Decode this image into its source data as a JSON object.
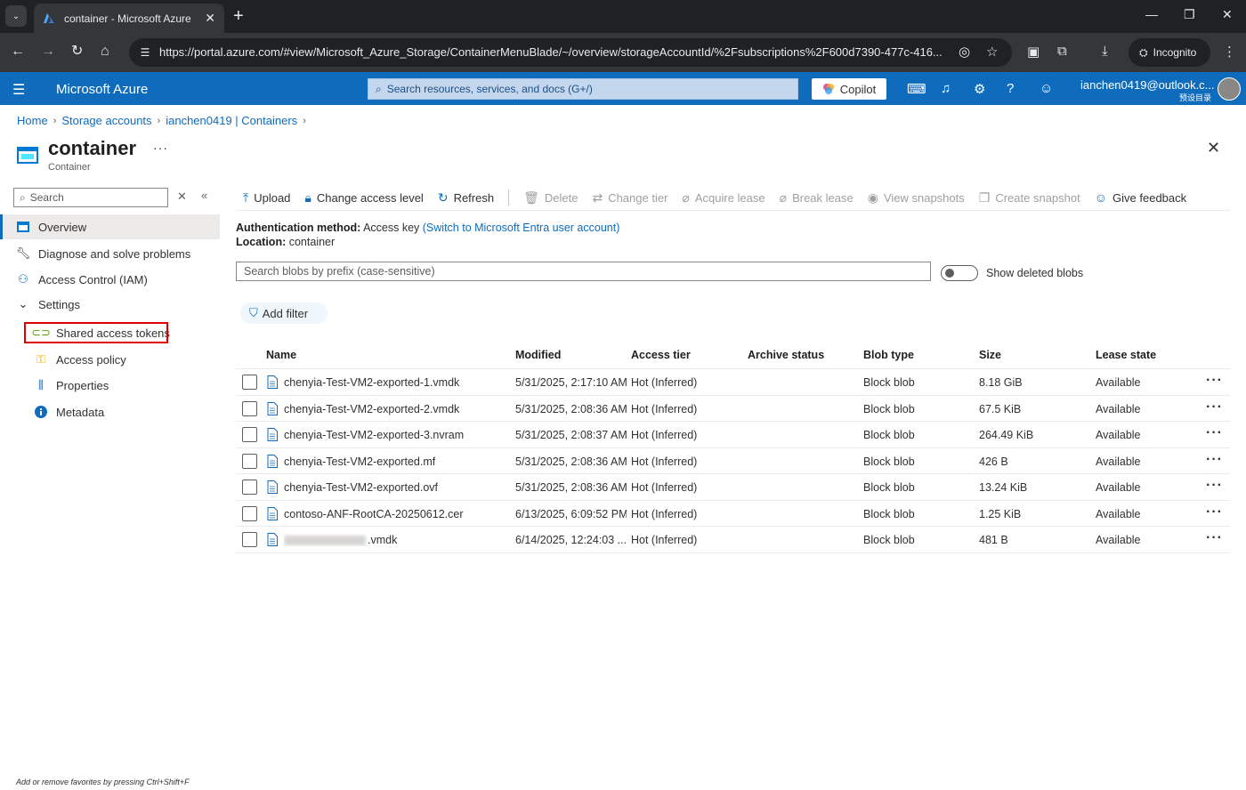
{
  "browser": {
    "tab_title": "container - Microsoft Azure",
    "url": "https://portal.azure.com/#view/Microsoft_Azure_Storage/ContainerMenuBlade/~/overview/storageAccountId/%2Fsubscriptions%2F600d7390-477c-416...",
    "incognito_label": "Incognito"
  },
  "header": {
    "brand": "Microsoft Azure",
    "search_placeholder": "Search resources, services, and docs (G+/)",
    "copilot_label": "Copilot",
    "user_email": "ianchen0419@outlook.c...",
    "user_directory": "预设目录"
  },
  "breadcrumb": [
    "Home",
    "Storage accounts",
    "ianchen0419 | Containers"
  ],
  "page": {
    "title": "container",
    "subtitle": "Container",
    "more": "···"
  },
  "nav": {
    "search_placeholder": "Search",
    "items": [
      {
        "label": "Overview",
        "icon": "overview-icon"
      },
      {
        "label": "Diagnose and solve problems",
        "icon": "wrench-icon"
      },
      {
        "label": "Access Control (IAM)",
        "icon": "people-icon"
      },
      {
        "label": "Settings",
        "icon": "chevron-down-icon"
      },
      {
        "label": "Shared access tokens",
        "icon": "link-icon"
      },
      {
        "label": "Access policy",
        "icon": "key-icon"
      },
      {
        "label": "Properties",
        "icon": "properties-icon"
      },
      {
        "label": "Metadata",
        "icon": "info-icon"
      }
    ],
    "favorites_hint": "Add or remove favorites by pressing Ctrl+Shift+F"
  },
  "commands": {
    "upload": "Upload",
    "change_access": "Change access level",
    "refresh": "Refresh",
    "delete": "Delete",
    "change_tier": "Change tier",
    "acquire_lease": "Acquire lease",
    "break_lease": "Break lease",
    "view_snapshots": "View snapshots",
    "create_snapshot": "Create snapshot",
    "give_feedback": "Give feedback"
  },
  "info": {
    "auth_label": "Authentication method:",
    "auth_value": "Access key",
    "auth_link": "(Switch to Microsoft Entra user account)",
    "location_label": "Location:",
    "location_value": "container"
  },
  "blob_search_placeholder": "Search blobs by prefix (case-sensitive)",
  "show_deleted_label": "Show deleted blobs",
  "add_filter_label": "Add filter",
  "table": {
    "columns": [
      "Name",
      "Modified",
      "Access tier",
      "Archive status",
      "Blob type",
      "Size",
      "Lease state"
    ],
    "rows": [
      {
        "name": "chenyia-Test-VM2-exported-1.vmdk",
        "modified": "5/31/2025, 2:17:10 AM",
        "tier": "Hot (Inferred)",
        "archive": "",
        "type": "Block blob",
        "size": "8.18 GiB",
        "lease": "Available"
      },
      {
        "name": "chenyia-Test-VM2-exported-2.vmdk",
        "modified": "5/31/2025, 2:08:36 AM",
        "tier": "Hot (Inferred)",
        "archive": "",
        "type": "Block blob",
        "size": "67.5 KiB",
        "lease": "Available"
      },
      {
        "name": "chenyia-Test-VM2-exported-3.nvram",
        "modified": "5/31/2025, 2:08:37 AM",
        "tier": "Hot (Inferred)",
        "archive": "",
        "type": "Block blob",
        "size": "264.49 KiB",
        "lease": "Available"
      },
      {
        "name": "chenyia-Test-VM2-exported.mf",
        "modified": "5/31/2025, 2:08:36 AM",
        "tier": "Hot (Inferred)",
        "archive": "",
        "type": "Block blob",
        "size": "426 B",
        "lease": "Available"
      },
      {
        "name": "chenyia-Test-VM2-exported.ovf",
        "modified": "5/31/2025, 2:08:36 AM",
        "tier": "Hot (Inferred)",
        "archive": "",
        "type": "Block blob",
        "size": "13.24 KiB",
        "lease": "Available"
      },
      {
        "name": "contoso-ANF-RootCA-20250612.cer",
        "modified": "6/13/2025, 6:09:52 PM",
        "tier": "Hot (Inferred)",
        "archive": "",
        "type": "Block blob",
        "size": "1.25 KiB",
        "lease": "Available"
      },
      {
        "name": ".vmdk",
        "modified": "6/14/2025, 12:24:03 ...",
        "tier": "Hot (Inferred)",
        "archive": "",
        "type": "Block blob",
        "size": "481 B",
        "lease": "Available",
        "name_redacted": true
      }
    ]
  },
  "colors": {
    "azure_blue": "#0f6cbd",
    "highlight_red": "#e00000"
  }
}
